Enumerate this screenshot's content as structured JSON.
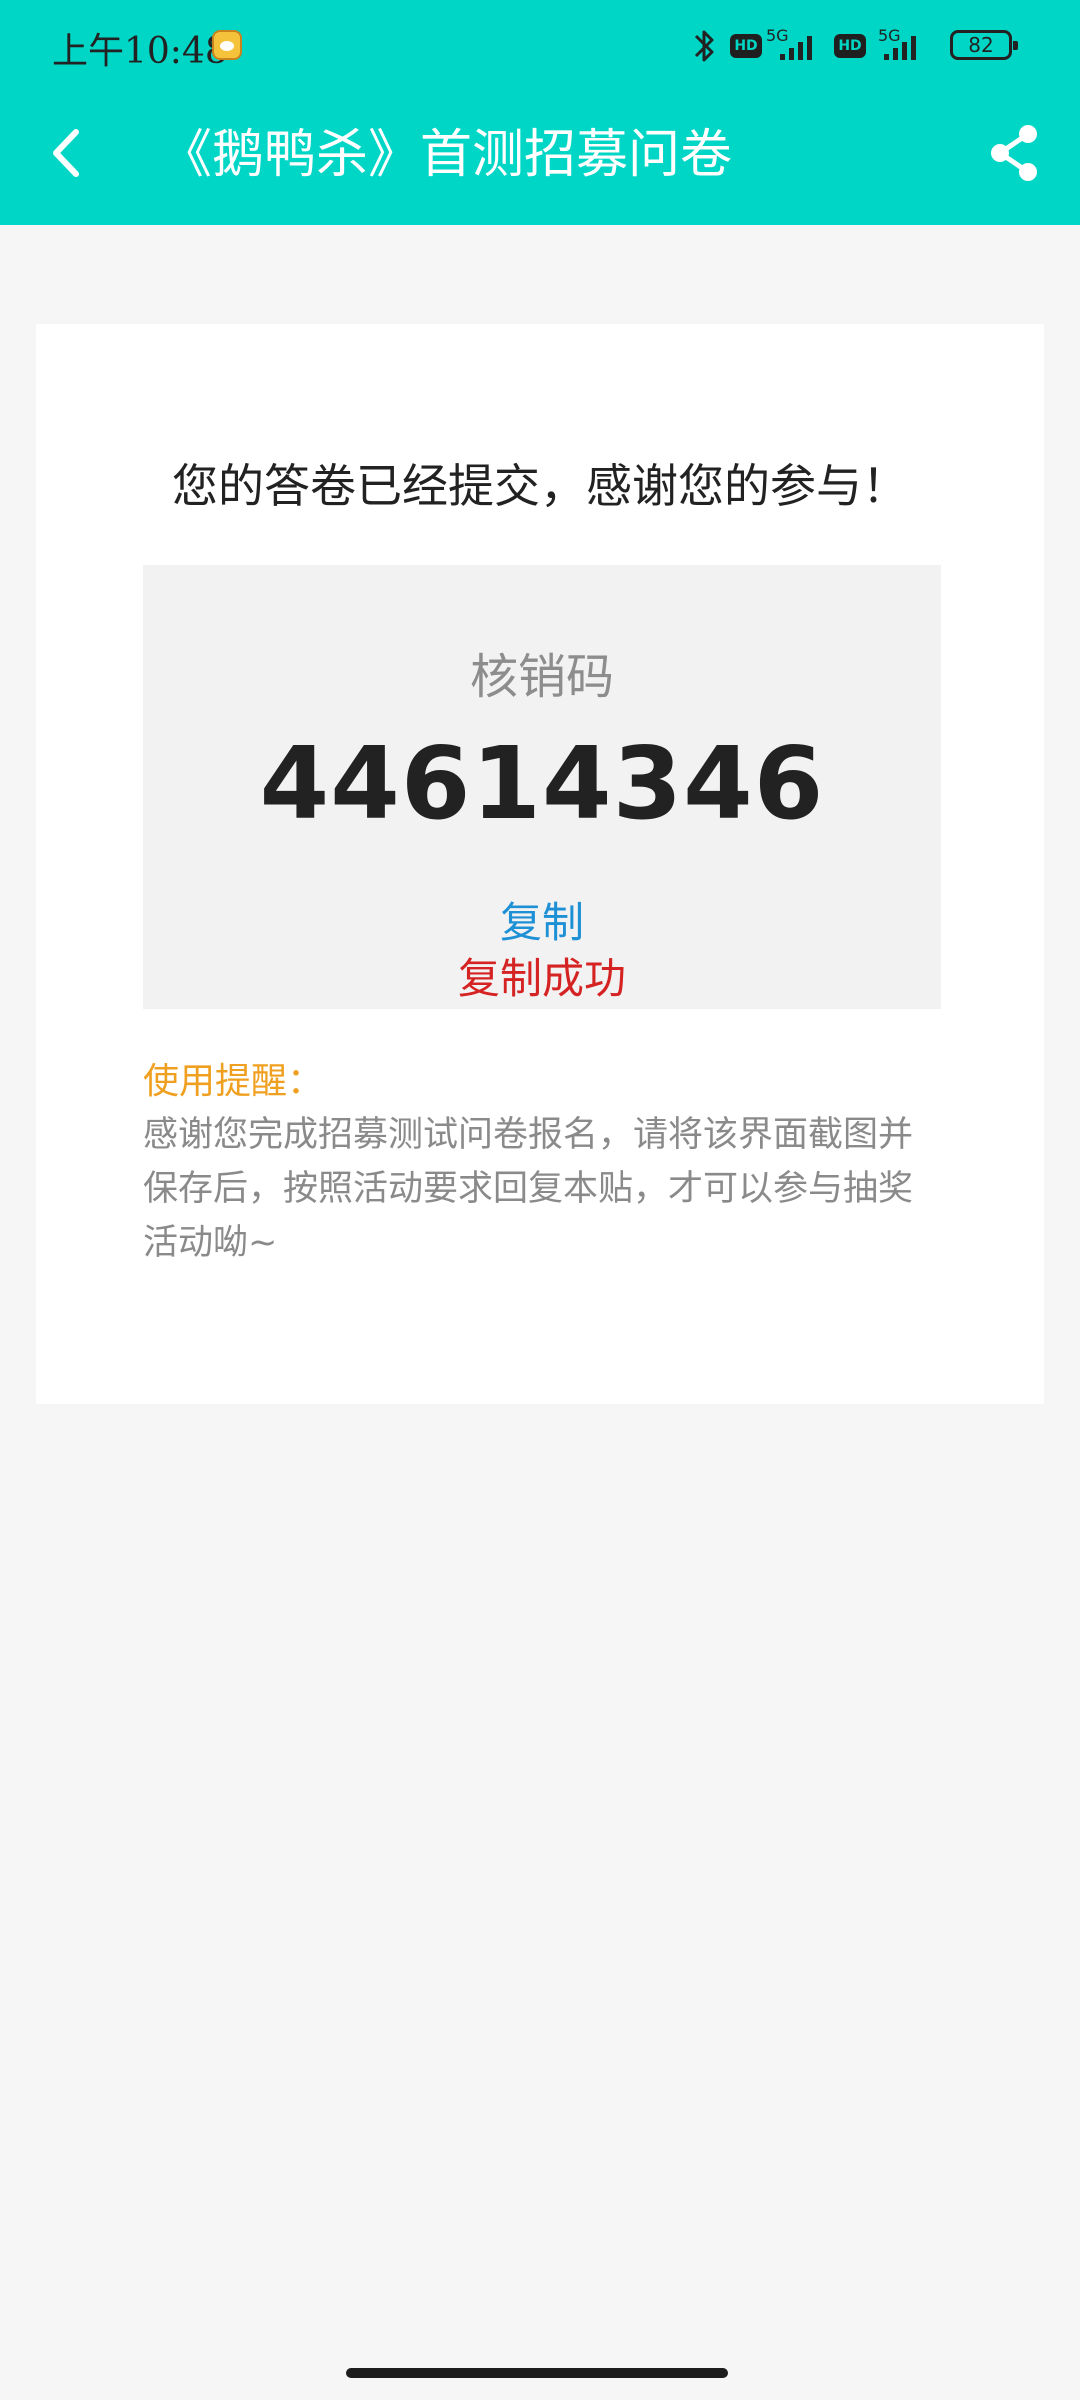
{
  "status_bar": {
    "time": "上午10:48",
    "network_1": "5G",
    "network_2": "5G",
    "hd_label": "HD",
    "battery": "82"
  },
  "header": {
    "title": "《鹅鸭杀》首测招募问卷"
  },
  "card": {
    "thanks_message": "您的答卷已经提交，感谢您的参与！",
    "code_label": "核销码",
    "code_value": "44614346",
    "copy_label": "复制",
    "copy_success": "复制成功",
    "reminder_title": "使用提醒：",
    "reminder_body": "感谢您完成招募测试问卷报名，请将该界面截图并保存后，按照活动要求回复本贴，才可以参与抽奖活动呦~"
  },
  "colors": {
    "header_bg": "#00d6c6",
    "copy_link": "#1e90d6",
    "success": "#d52222",
    "reminder": "#f0a020"
  }
}
